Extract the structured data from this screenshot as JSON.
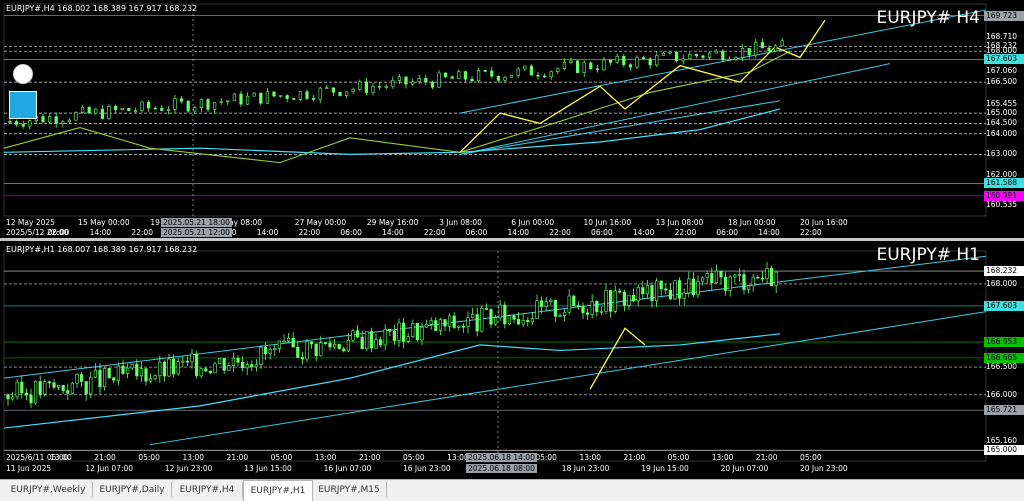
{
  "top_chart": {
    "info": "EURJPY#,H4  168.002 168.389 167.917 168.232",
    "title": "EURJPY# H4",
    "price_labels": [
      {
        "text": "169.723",
        "color": "#9aa0a6",
        "tag": true,
        "price": 169.723
      },
      {
        "text": "168.232",
        "color": "#ffffff",
        "tag": false,
        "price": 168.232
      },
      {
        "text": "168.000",
        "color": "#ffffff",
        "tag": false,
        "price": 168.0
      },
      {
        "text": "167.603",
        "color": "#40e0e0",
        "tag": true,
        "price": 167.603
      },
      {
        "text": "166.500",
        "color": "#ffffff",
        "tag": false,
        "price": 166.5
      },
      {
        "text": "165.000",
        "color": "#ffffff",
        "tag": false,
        "price": 165.0
      },
      {
        "text": "164.500",
        "color": "#ffffff",
        "tag": false,
        "price": 164.5
      },
      {
        "text": "164.000",
        "color": "#ffffff",
        "tag": false,
        "price": 164.0
      },
      {
        "text": "163.000",
        "color": "#ffffff",
        "tag": false,
        "price": 163.0
      },
      {
        "text": "161.588",
        "color": "#40e0e0",
        "tag": true,
        "price": 161.588
      },
      {
        "text": "160.991",
        "color": "#ff00ff",
        "tag": true,
        "price": 160.991
      }
    ],
    "axis_ticks": [
      {
        "text": "168.710",
        "price": 168.71
      },
      {
        "text": "167.060",
        "price": 167.06
      },
      {
        "text": "165.455",
        "price": 165.455
      },
      {
        "text": "162.000",
        "price": 162.0
      },
      {
        "text": "160.535",
        "price": 160.535
      }
    ],
    "time_labels": [
      "2025/5/12 22:00",
      "06:00",
      "14:00",
      "22:00",
      "22:00",
      "06:00",
      "14:00",
      "22:00",
      "06:00",
      "14:00",
      "22:00",
      "06:00",
      "14:00",
      "22:00",
      "06:00",
      "14:00",
      "22:00",
      "06:00",
      "14:00",
      "22:00"
    ],
    "time_labels_2": [
      "12 May 2025",
      "15 May 00:00",
      "19 May",
      "May 08:00",
      "27 May 00:00",
      "29 May 16:00",
      "3 Jun 08:00",
      "6 Jun 00:00",
      "10 Jun 16:00",
      "13 Jun 08:00",
      "18 Jun 00:00",
      "20 Jun 16:00"
    ],
    "crosshair_tags": [
      "2025.05.21 18:00",
      "2025.05.21 12:00"
    ]
  },
  "bottom_chart": {
    "info": "EURJPY#,H1  168.007 168.389 167.917 168.232",
    "title": "EURJPY# H1",
    "price_labels": [
      {
        "text": "168.232",
        "color": "#ffffff",
        "tag": true,
        "price": 168.232
      },
      {
        "text": "168.000",
        "color": "#ffffff",
        "tag": false,
        "price": 168.0
      },
      {
        "text": "167.603",
        "color": "#40e0e0",
        "tag": true,
        "price": 167.603
      },
      {
        "text": "166.953",
        "color": "#00c000",
        "tag": true,
        "price": 166.953
      },
      {
        "text": "166.665",
        "color": "#00c000",
        "tag": true,
        "price": 166.665
      },
      {
        "text": "166.500",
        "color": "#ffffff",
        "tag": false,
        "price": 166.5
      },
      {
        "text": "166.000",
        "color": "#ffffff",
        "tag": false,
        "price": 166.0
      },
      {
        "text": "165.721",
        "color": "#9aa0a6",
        "tag": true,
        "price": 165.721
      },
      {
        "text": "165.000",
        "color": "#ffffff",
        "tag": true,
        "price": 165.0
      }
    ],
    "axis_ticks": [
      {
        "text": "165.160",
        "price": 165.16
      }
    ],
    "time_labels": [
      "11 Jun 2025",
      "12 Jun 07:00",
      "12 Jun 23:00",
      "13 Jun 15:00",
      "16 Jun 07:00",
      "16 Jun 23:00",
      "17 Jun 15:00",
      "18 Jun 23:00",
      "19 Jun 15:00",
      "20 Jun 07:00",
      "20 Jun 23:00"
    ],
    "time_labels_2": [
      "2025/6/11 05:00",
      "13:00",
      "21:00",
      "05:00",
      "13:00",
      "21:00",
      "05:00",
      "13:00",
      "21:00",
      "05:00",
      "13:00",
      "21:00",
      "05:00",
      "13:00",
      "21:00",
      "05:00",
      "13:00",
      "21:00",
      "05:00"
    ],
    "crosshair_tags": [
      "2025.06.18 14:00",
      "2025.06.18 08:00"
    ]
  },
  "tabs": [
    {
      "label": "EURJPY#,Weekly",
      "active": false
    },
    {
      "label": "EURJPY#,Daily",
      "active": false
    },
    {
      "label": "EURJPY#,H4",
      "active": false
    },
    {
      "label": "EURJPY#,H1",
      "active": true
    },
    {
      "label": "EURJPY#,M15",
      "active": false
    }
  ],
  "colors": {
    "background": "#000000",
    "grid_line": "#ffffff",
    "channel": "#40c8e8",
    "ma_fast": "#9acd32",
    "ma_slow": "#40e0ff",
    "zigzag": "#ffff40",
    "candle": "#66ff66",
    "magenta": "#ff00ff",
    "support": "#00c000"
  },
  "icons": [
    "pen-icon",
    "face-icon"
  ]
}
